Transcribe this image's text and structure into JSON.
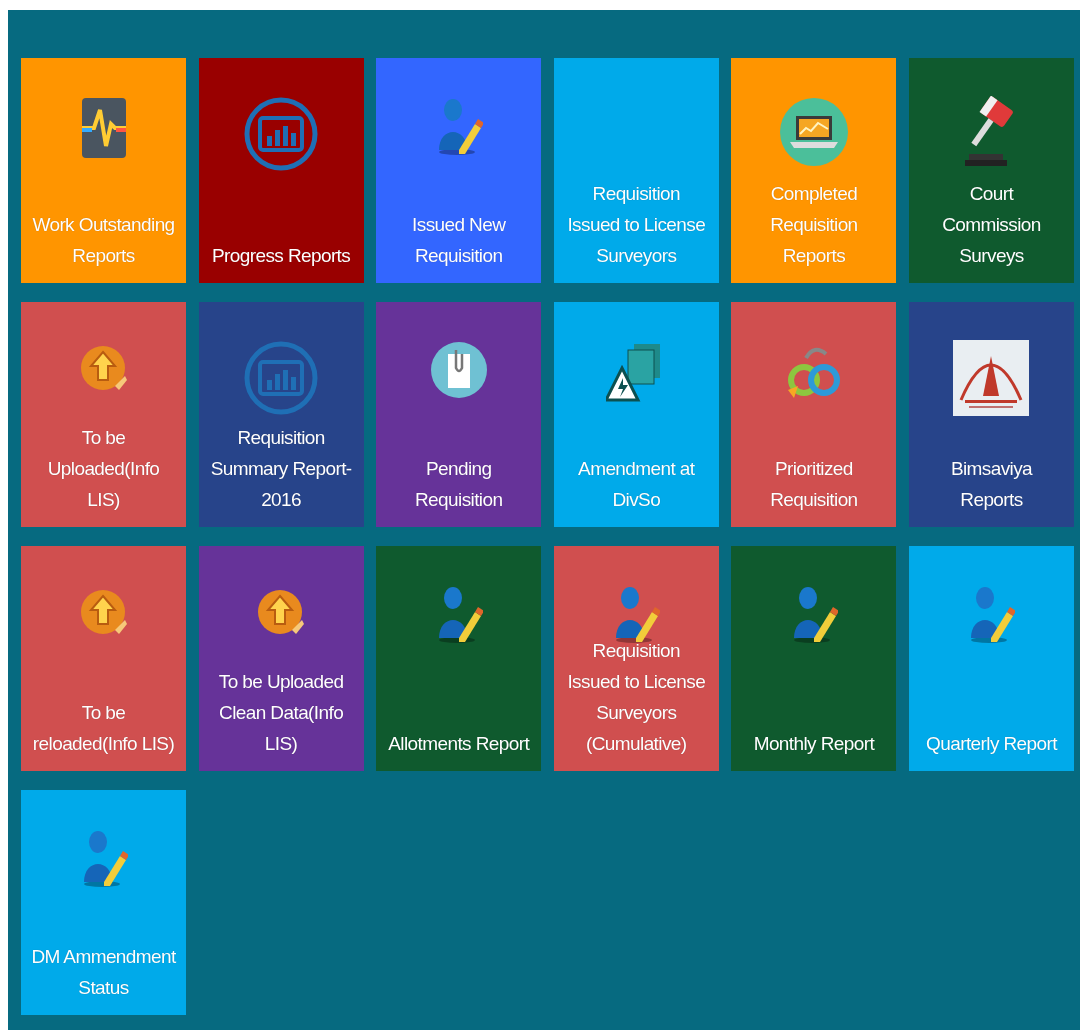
{
  "tiles": [
    {
      "lines": [
        "Work Outstanding",
        "Reports"
      ],
      "color": "#ff9500",
      "kind": "monitor"
    },
    {
      "lines": [
        "Progress Reports"
      ],
      "color": "#990000",
      "kind": "chart"
    },
    {
      "lines": [
        "Issued New",
        "Requisition"
      ],
      "color": "#3366ff",
      "kind": "user"
    },
    {
      "lines": [
        "Requisition",
        "Issued to License",
        "Surveyors"
      ],
      "color": "#00aaea",
      "kind": "plain"
    },
    {
      "lines": [
        "Completed",
        "Requisition",
        "Reports"
      ],
      "color": "#ff9500",
      "kind": "laptop"
    },
    {
      "lines": [
        "Court",
        "Commission",
        "Surveys"
      ],
      "color": "#0f5a2e",
      "kind": "gavel"
    },
    {
      "lines": [
        "To be",
        "Uploaded(Info",
        "LIS)"
      ],
      "color": "#d04f4f",
      "kind": "upload"
    },
    {
      "lines": [
        "Requisition",
        "Summary Report-",
        "2016"
      ],
      "color": "#27448a",
      "kind": "chart"
    },
    {
      "lines": [
        "Pending",
        "Requisition"
      ],
      "color": "#663399",
      "kind": "clip"
    },
    {
      "lines": [
        "Amendment at",
        "DivSo"
      ],
      "color": "#00aaea",
      "kind": "docs"
    },
    {
      "lines": [
        "Prioritized",
        "Requisition"
      ],
      "color": "#d04f4f",
      "kind": "sync"
    },
    {
      "lines": [
        "Bimsaviya",
        "Reports"
      ],
      "color": "#27448a",
      "kind": "emblem"
    },
    {
      "lines": [
        "To be",
        "reloaded(Info LIS)"
      ],
      "color": "#d04f4f",
      "kind": "upload"
    },
    {
      "lines": [
        "To be Uploaded",
        "Clean Data(Info",
        "LIS)"
      ],
      "color": "#663399",
      "kind": "upload"
    },
    {
      "lines": [
        "Allotments Report"
      ],
      "color": "#0f5a2e",
      "kind": "user"
    },
    {
      "lines": [
        "Requisition",
        "Issued to License",
        "Surveyors",
        "(Cumulative)"
      ],
      "color": "#d04f4f",
      "kind": "user"
    },
    {
      "lines": [
        "Monthly Report"
      ],
      "color": "#0f5a2e",
      "kind": "user"
    },
    {
      "lines": [
        "Quarterly Report"
      ],
      "color": "#00aaea",
      "kind": "user"
    },
    {
      "lines": [
        "DM Ammendment",
        "Status"
      ],
      "color": "#00aaea",
      "kind": "user"
    }
  ]
}
